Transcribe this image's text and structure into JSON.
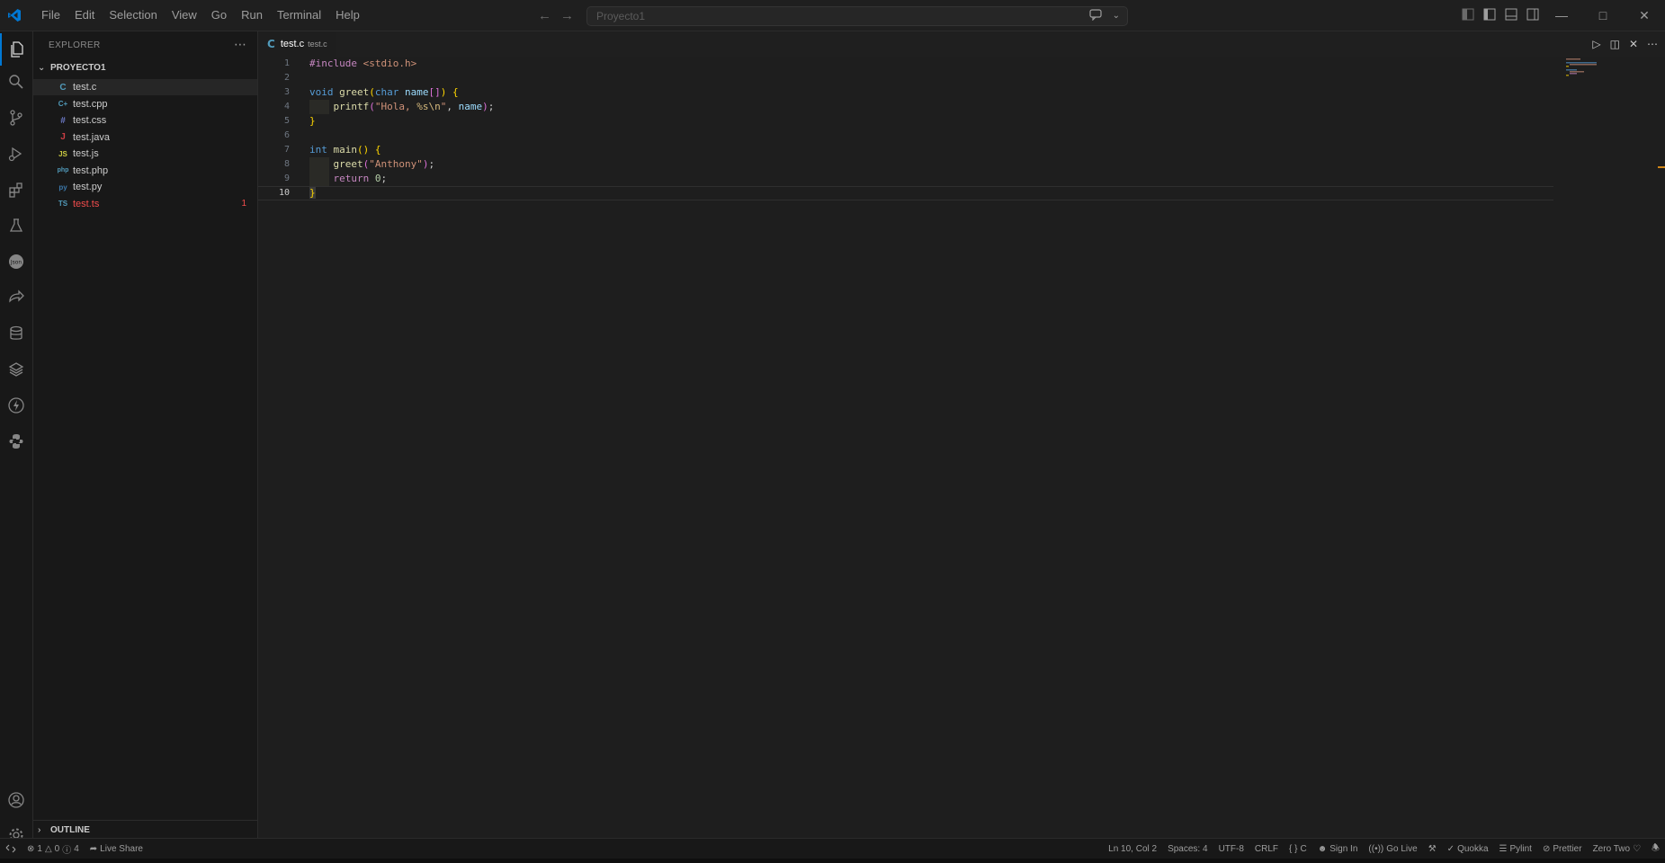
{
  "titlebar": {
    "menu": [
      "File",
      "Edit",
      "Selection",
      "View",
      "Go",
      "Run",
      "Terminal",
      "Help"
    ],
    "search_text": "Proyecto1"
  },
  "sidebar": {
    "title": "EXPLORER",
    "folder": "PROYECTO1",
    "files": [
      {
        "name": "test.c",
        "icon": "c-file-icon",
        "glyph": "C",
        "color": "#519aba",
        "selected": true,
        "error": false,
        "badge": ""
      },
      {
        "name": "test.cpp",
        "icon": "cpp-file-icon",
        "glyph": "C+",
        "color": "#519aba",
        "selected": false,
        "error": false,
        "badge": ""
      },
      {
        "name": "test.css",
        "icon": "css-file-icon",
        "glyph": "#",
        "color": "#6e7cc9",
        "selected": false,
        "error": false,
        "badge": ""
      },
      {
        "name": "test.java",
        "icon": "java-file-icon",
        "glyph": "J",
        "color": "#cc3e44",
        "selected": false,
        "error": false,
        "badge": ""
      },
      {
        "name": "test.js",
        "icon": "js-file-icon",
        "glyph": "JS",
        "color": "#cbcb41",
        "selected": false,
        "error": false,
        "badge": ""
      },
      {
        "name": "test.php",
        "icon": "php-file-icon",
        "glyph": "php",
        "color": "#519aba",
        "selected": false,
        "error": false,
        "badge": ""
      },
      {
        "name": "test.py",
        "icon": "python-file-icon",
        "glyph": "py",
        "color": "#3c78aa",
        "selected": false,
        "error": false,
        "badge": ""
      },
      {
        "name": "test.ts",
        "icon": "ts-file-icon",
        "glyph": "TS",
        "color": "#519aba",
        "selected": false,
        "error": true,
        "badge": "1"
      }
    ],
    "outline": "OUTLINE"
  },
  "editor": {
    "tab_label": "test.c",
    "tab_description": "test.c",
    "line_numbers": [
      "1",
      "2",
      "3",
      "4",
      "5",
      "6",
      "7",
      "8",
      "9",
      "10"
    ],
    "current_line": 10
  },
  "statusbar": {
    "errors": "1",
    "warnings": "0",
    "infos": "4",
    "live_share": "Live Share",
    "position": "Ln 10, Col 2",
    "spaces": "Spaces: 4",
    "encoding": "UTF-8",
    "eol": "CRLF",
    "language": "C",
    "sign_in": "Sign In",
    "go_live": "Go Live",
    "quokka": "Quokka",
    "pylint": "Pylint",
    "prettier": "Prettier",
    "theme": "Zero Two"
  },
  "colors": {
    "accent": "#0078d4",
    "background": "#1e1e1e",
    "error": "#f14c4c"
  }
}
